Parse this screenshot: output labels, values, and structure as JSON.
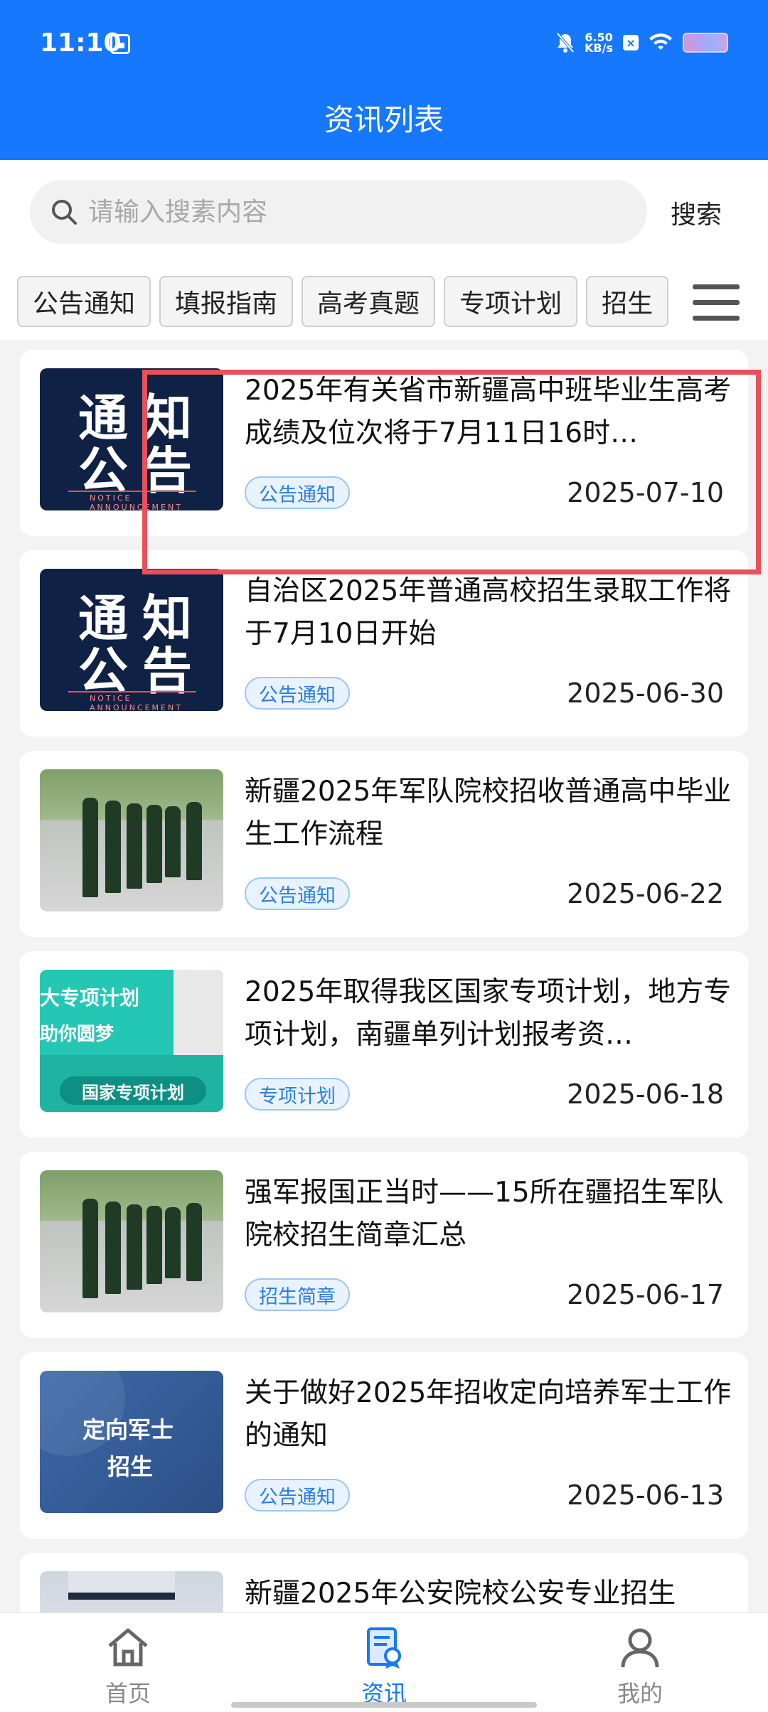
{
  "status_bar": {
    "time": "11:10",
    "speed_value": "6.50",
    "speed_unit": "KB/s",
    "icons": [
      "calendar-icon",
      "mute-icon",
      "close-box-icon",
      "wifi-icon",
      "battery-icon"
    ]
  },
  "header": {
    "title": "资讯列表",
    "color": "#1677ff"
  },
  "search": {
    "placeholder": "请输入搜素内容",
    "button_label": "搜索"
  },
  "tabs": [
    "公告通知",
    "填报指南",
    "高考真题",
    "专项计划",
    "招生"
  ],
  "news": [
    {
      "title": "2025年有关省市新疆高中班毕业生高考成绩及位次将于7月11日16时…",
      "tag": "公告通知",
      "date": "2025-07-10",
      "thumb_label_1": "通知",
      "thumb_label_2": "公告",
      "thumb_caption": "NOTICE ANNOUNCEMENT"
    },
    {
      "title": "自治区2025年普通高校招生录取工作将于7月10日开始",
      "tag": "公告通知",
      "date": "2025-06-30",
      "thumb_label_1": "通知",
      "thumb_label_2": "公告",
      "thumb_caption": "NOTICE ANNOUNCEMENT"
    },
    {
      "title": "新疆2025年军队院校招收普通高中毕业生工作流程",
      "tag": "公告通知",
      "date": "2025-06-22"
    },
    {
      "title": "2025年取得我区国家专项计划，地方专项计划，南疆单列计划报考资…",
      "tag": "专项计划",
      "date": "2025-06-18",
      "thumb_label_1": "大专项计划",
      "thumb_label_2": "助你圆梦",
      "thumb_label_3": "国家专项计划"
    },
    {
      "title": "强军报国正当时——15所在疆招生军队院校招生简章汇总",
      "tag": "招生简章",
      "date": "2025-06-17"
    },
    {
      "title": "关于做好2025年招收定向培养军士工作的通知",
      "tag": "公告通知",
      "date": "2025-06-13",
      "thumb_label_1": "定向军士",
      "thumb_label_2": "招生"
    },
    {
      "title": "新疆2025年公安院校公安专业招生",
      "tag": "",
      "date": ""
    }
  ],
  "bottom_nav": [
    {
      "label": "首页",
      "icon": "home-icon",
      "active": false
    },
    {
      "label": "资讯",
      "icon": "news-icon",
      "active": true
    },
    {
      "label": "我的",
      "icon": "profile-icon",
      "active": false
    }
  ]
}
